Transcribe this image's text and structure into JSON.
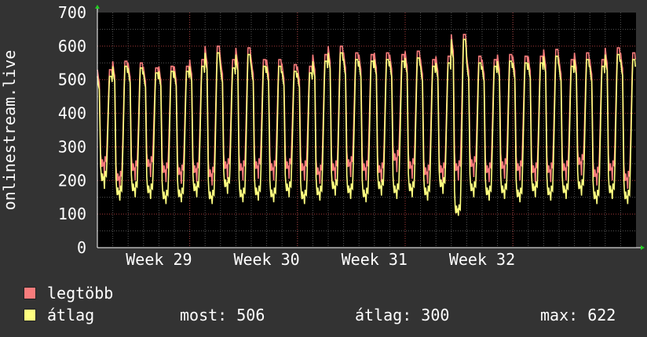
{
  "chart_data": {
    "type": "line",
    "ylabel": "onlinestream.live",
    "ylim": [
      0,
      700
    ],
    "yticks": [
      0,
      100,
      200,
      300,
      400,
      500,
      600,
      700
    ],
    "xtick_labels": [
      "Week 29",
      "Week 30",
      "Week 31",
      "Week 32"
    ],
    "grid": true,
    "days": 35,
    "series": [
      {
        "name": "legtöbb",
        "color": "#f87c7c",
        "daily_peak": [
          530,
          555,
          550,
          535,
          540,
          540,
          560,
          600,
          560,
          595,
          560,
          560,
          545,
          540,
          575,
          600,
          580,
          575,
          580,
          575,
          585,
          560,
          570,
          635,
          570,
          560,
          575,
          570,
          570,
          590,
          560,
          580,
          560,
          595,
          580
        ],
        "daily_low": [
          210,
          175,
          200,
          210,
          195,
          190,
          195,
          185,
          205,
          200,
          205,
          200,
          205,
          200,
          190,
          200,
          210,
          200,
          195,
          225,
          205,
          190,
          195,
          200,
          210,
          195,
          205,
          200,
          195,
          195,
          200,
          215,
          185,
          200,
          175
        ]
      },
      {
        "name": "átlag",
        "color": "#ffff80",
        "daily_peak": [
          510,
          540,
          535,
          520,
          525,
          525,
          540,
          580,
          535,
          575,
          540,
          540,
          525,
          520,
          555,
          580,
          560,
          555,
          560,
          555,
          565,
          540,
          550,
          620,
          550,
          540,
          555,
          550,
          550,
          570,
          540,
          560,
          540,
          575,
          560
        ],
        "daily_low": [
          175,
          140,
          150,
          145,
          130,
          135,
          150,
          130,
          160,
          135,
          140,
          135,
          150,
          130,
          140,
          155,
          145,
          135,
          155,
          145,
          150,
          140,
          160,
          95,
          150,
          140,
          145,
          135,
          150,
          140,
          145,
          155,
          130,
          145,
          130
        ]
      }
    ],
    "stats": [
      {
        "label": "most:",
        "value": "506"
      },
      {
        "label": "átlag:",
        "value": "300"
      },
      {
        "label": "max:",
        "value": "622"
      }
    ]
  },
  "legend": [
    {
      "label": "legtöbb",
      "color": "#f87c7c"
    },
    {
      "label": "átlag",
      "color": "#ffff80"
    }
  ]
}
